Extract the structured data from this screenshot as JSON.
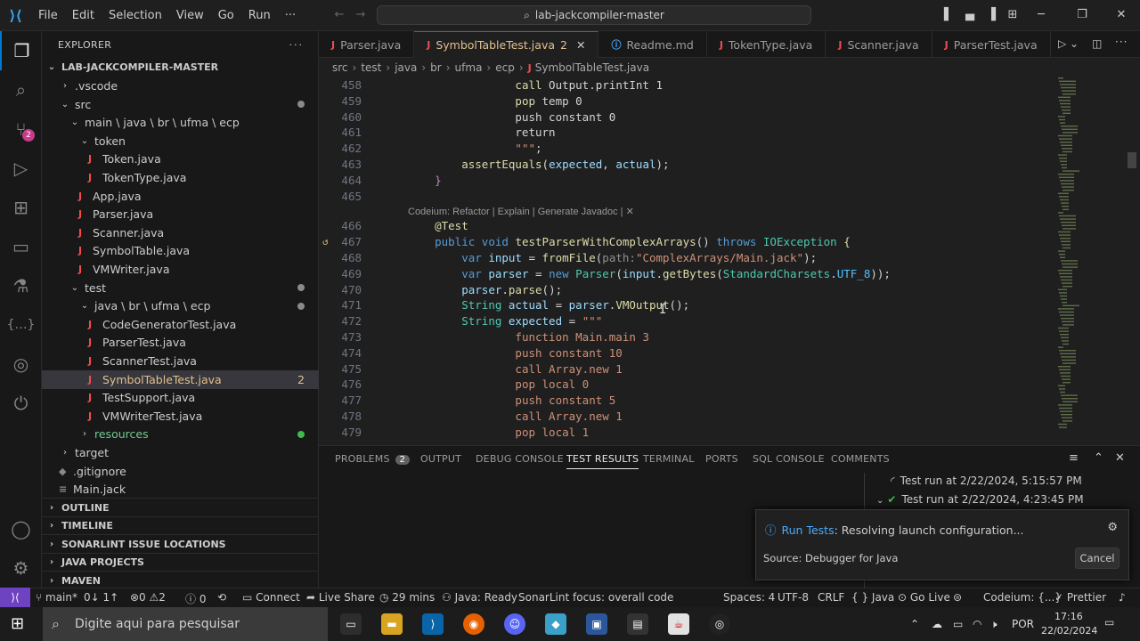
{
  "window": {
    "menu": [
      "File",
      "Edit",
      "Selection",
      "View",
      "Go",
      "Run",
      "···"
    ],
    "search": "lab-jackcompiler-master"
  },
  "activity": {
    "scm_badge": "2"
  },
  "explorer": {
    "title": "EXPLORER",
    "root": "LAB-JACKCOMPILER-MASTER",
    "tree": [
      {
        "label": ".vscode",
        "depth": 1,
        "chev": "›",
        "java": false
      },
      {
        "label": "src",
        "depth": 1,
        "chev": "⌄",
        "java": false,
        "dot": "#8a8a8a"
      },
      {
        "label": "main \\ java \\ br \\ ufma \\ ecp",
        "depth": 2,
        "chev": "⌄",
        "java": false
      },
      {
        "label": "token",
        "depth": 3,
        "chev": "⌄",
        "java": false
      },
      {
        "label": "Token.java",
        "depth": 4,
        "java": true
      },
      {
        "label": "TokenType.java",
        "depth": 4,
        "java": true
      },
      {
        "label": "App.java",
        "depth": 3,
        "java": true
      },
      {
        "label": "Parser.java",
        "depth": 3,
        "java": true
      },
      {
        "label": "Scanner.java",
        "depth": 3,
        "java": true
      },
      {
        "label": "SymbolTable.java",
        "depth": 3,
        "java": true
      },
      {
        "label": "VMWriter.java",
        "depth": 3,
        "java": true
      },
      {
        "label": "test",
        "depth": 2,
        "chev": "⌄",
        "java": false,
        "dot": "#8a8a8a"
      },
      {
        "label": "java \\ br \\ ufma \\ ecp",
        "depth": 3,
        "chev": "⌄",
        "java": false,
        "dot": "#8a8a8a"
      },
      {
        "label": "CodeGeneratorTest.java",
        "depth": 4,
        "java": true
      },
      {
        "label": "ParserTest.java",
        "depth": 4,
        "java": true
      },
      {
        "label": "ScannerTest.java",
        "depth": 4,
        "java": true
      },
      {
        "label": "SymbolTableTest.java",
        "depth": 4,
        "java": true,
        "selected": true,
        "count": "2"
      },
      {
        "label": "TestSupport.java",
        "depth": 4,
        "java": true
      },
      {
        "label": "VMWriterTest.java",
        "depth": 4,
        "java": true
      },
      {
        "label": "resources",
        "depth": 3,
        "chev": "›",
        "java": false,
        "dot": "#3fb950",
        "green": true
      },
      {
        "label": "target",
        "depth": 1,
        "chev": "›",
        "java": false
      },
      {
        "label": ".gitignore",
        "depth": 1,
        "java": false,
        "glyph": "◆"
      },
      {
        "label": "Main.jack",
        "depth": 1,
        "java": false,
        "glyph": "≡"
      }
    ],
    "sections": [
      "OUTLINE",
      "TIMELINE",
      "SONARLINT ISSUE LOCATIONS",
      "JAVA PROJECTS",
      "MAVEN"
    ]
  },
  "tabs": [
    {
      "label": "Parser.java",
      "icon": "J"
    },
    {
      "label": "SymbolTableTest.java",
      "icon": "J",
      "active": true,
      "num": "2"
    },
    {
      "label": "Readme.md",
      "icon": "ⓘ",
      "info": true
    },
    {
      "label": "TokenType.java",
      "icon": "J"
    },
    {
      "label": "Scanner.java",
      "icon": "J"
    },
    {
      "label": "ParserTest.java",
      "icon": "J"
    }
  ],
  "breadcrumb": [
    "src",
    "test",
    "java",
    "br",
    "ufma",
    "ecp",
    "SymbolTableTest.java"
  ],
  "code": {
    "codelens": "Codeium: Refactor | Explain | Generate Javadoc | ✕",
    "lines": [
      {
        "n": "458",
        "html": "                <span class='fn'>call</span> Output.printInt 1"
      },
      {
        "n": "459",
        "html": "                <span class='fn'>pop</span> temp 0"
      },
      {
        "n": "460",
        "html": "                push constant 0"
      },
      {
        "n": "461",
        "html": "                return"
      },
      {
        "n": "462",
        "html": "                <span class='str'>\"\"\"</span>;"
      },
      {
        "n": "463",
        "html": "        <span class='fn'>assertEquals</span>(<span class='var'>expected</span>, <span class='var'>actual</span>);"
      },
      {
        "n": "464",
        "html": "    <span class='kw'>}</span>"
      },
      {
        "n": "465",
        "html": ""
      },
      {
        "n": "466",
        "html": "    <span class='anno'>@Test</span>"
      },
      {
        "n": "467",
        "html": "    <span class='kb'>public</span> <span class='kb'>void</span> <span class='fn'>testParserWithComplexArrays</span>() <span class='kb'>throws</span> <span class='ty'>IOException</span> <span class='fn'>{</span>"
      },
      {
        "n": "468",
        "html": "        <span class='kb'>var</span> <span class='var'>input</span> = <span class='fn'>fromFile</span>(<span class='hint'>path:</span><span class='str'>\"ComplexArrays/Main.jack\"</span>);"
      },
      {
        "n": "469",
        "html": "        <span class='kb'>var</span> <span class='var'>parser</span> = <span class='kb'>new</span> <span class='ty'>Parser</span>(<span class='var'>input</span>.<span class='fn'>getBytes</span>(<span class='ty'>StandardCharsets</span>.<span class='const'>UTF_8</span>));"
      },
      {
        "n": "470",
        "html": "        <span class='var'>parser</span>.<span class='fn'>parse</span>();"
      },
      {
        "n": "471",
        "html": "        <span class='ty'>String</span> <span class='var'>actual</span> = <span class='var'>parser</span>.<span class='fn'>VMOutput</span>();"
      },
      {
        "n": "472",
        "html": "        <span class='ty'>String</span> <span class='var'>expected</span> = <span class='str'>\"\"\"</span>"
      },
      {
        "n": "473",
        "html": "                <span class='str'>function Main.main 3</span>"
      },
      {
        "n": "474",
        "html": "                <span class='str'>push constant 10</span>"
      },
      {
        "n": "475",
        "html": "                <span class='str'>call Array.new 1</span>"
      },
      {
        "n": "476",
        "html": "                <span class='str'>pop local 0</span>"
      },
      {
        "n": "477",
        "html": "                <span class='str'>push constant 5</span>"
      },
      {
        "n": "478",
        "html": "                <span class='str'>call Array.new 1</span>"
      },
      {
        "n": "479",
        "html": "                <span class='str'>pop local 1</span>"
      }
    ]
  },
  "panel": {
    "tabs": [
      "PROBLEMS",
      "OUTPUT",
      "DEBUG CONSOLE",
      "TEST RESULTS",
      "TERMINAL",
      "PORTS",
      "SQL CONSOLE",
      "COMMENTS"
    ],
    "problems_count": "2",
    "active": "TEST RESULTS",
    "runs": [
      "Test run at 2/22/2024, 5:15:57 PM",
      "Test run at 2/22/2024, 4:23:45 PM"
    ]
  },
  "notification": {
    "link": "Run Tests",
    "message": ": Resolving launch configuration...",
    "source": "Source: Debugger for Java",
    "cancel": "Cancel"
  },
  "status": {
    "branch": "main*",
    "sync": "0↓ 1↑",
    "errors": "⊗0 ⚠2",
    "info": "ⓘ 0",
    "connect": "Connect",
    "liveshare": "Live Share",
    "time": "29 mins",
    "java": "Java: Ready",
    "sonar": "SonarLint focus: overall code",
    "spaces": "Spaces: 4",
    "encoding": "UTF-8",
    "eol": "CRLF",
    "lang": "{ } Java",
    "golive": "Go Live",
    "codeium": "Codeium: {...}",
    "prettier": "Prettier"
  },
  "taskbar": {
    "search": "Digite aqui para pesquisar",
    "lang": "POR",
    "time": "17:16",
    "date": "22/02/2024"
  }
}
